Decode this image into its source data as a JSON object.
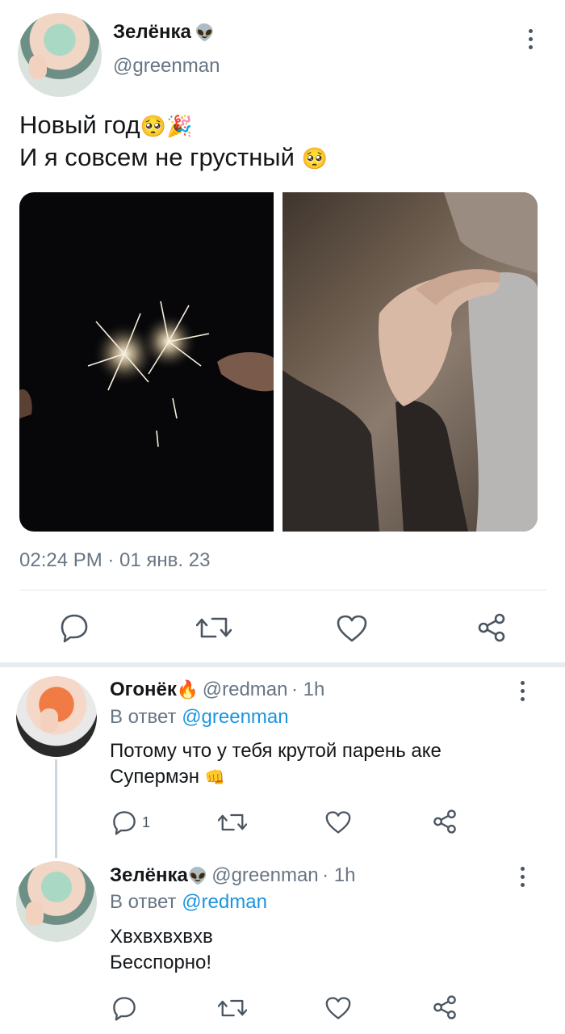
{
  "main_tweet": {
    "author_name": "Зелёнка",
    "author_emoji": "👽",
    "handle": "@greenman",
    "text_line1": "Новый год",
    "text_line1_emoji": "🥺🎉",
    "text_line2": "И я совсем не грустный",
    "text_line2_emoji": "🥺",
    "timestamp": "02:24 PM · 01 янв. 23"
  },
  "replies": [
    {
      "author_name": "Огонёк",
      "author_emoji": "🔥",
      "handle": "@redman",
      "time": "· 1h",
      "reply_to_prefix": "В ответ",
      "reply_to": "@greenman",
      "text_line1": "Потому что у тебя крутой парень аке",
      "text_line2": "Супермэн",
      "text_line2_emoji": "👊",
      "reply_count": "1"
    },
    {
      "author_name": "Зелёнка",
      "author_emoji": "👽",
      "handle": "@greenman",
      "time": "· 1h",
      "reply_to_prefix": "В ответ",
      "reply_to": "@redman",
      "text_line1": "Хвхвхвхвхв",
      "text_line2": "Бесспорно!",
      "reply_count": ""
    }
  ],
  "icons": {
    "reply": "reply-icon",
    "retweet": "retweet-icon",
    "like": "heart-icon",
    "share": "share-icon",
    "more": "more-icon"
  },
  "colors": {
    "link": "#1b95e0",
    "secondary_text": "#687684",
    "icon": "#4a5561"
  }
}
